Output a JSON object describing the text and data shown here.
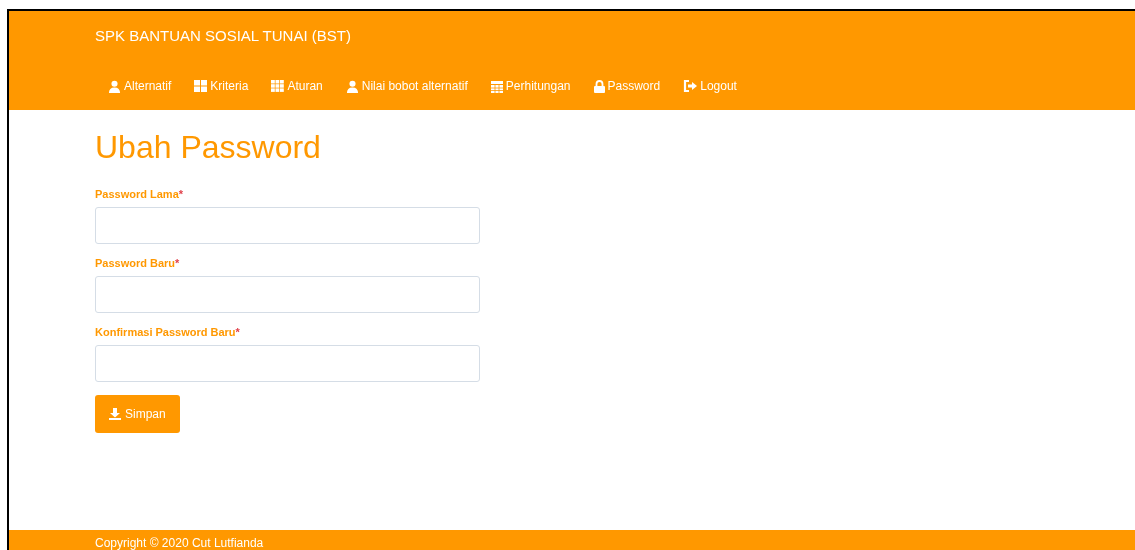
{
  "navbar": {
    "brand": "SPK BANTUAN SOSIAL TUNAI (BST)",
    "items": [
      {
        "label": "Alternatif"
      },
      {
        "label": "Kriteria"
      },
      {
        "label": "Aturan"
      },
      {
        "label": "Nilai bobot alternatif"
      },
      {
        "label": "Perhitungan"
      },
      {
        "label": "Password"
      },
      {
        "label": "Logout"
      }
    ]
  },
  "page": {
    "title": "Ubah Password",
    "fields": [
      {
        "label": "Password Lama",
        "required_mark": "*"
      },
      {
        "label": "Password Baru",
        "required_mark": "*"
      },
      {
        "label": "Konfirmasi Password Baru",
        "required_mark": "*"
      }
    ],
    "submit_button": "Simpan"
  },
  "footer": {
    "text": "Copyright © 2020 Cut Lutfianda"
  }
}
